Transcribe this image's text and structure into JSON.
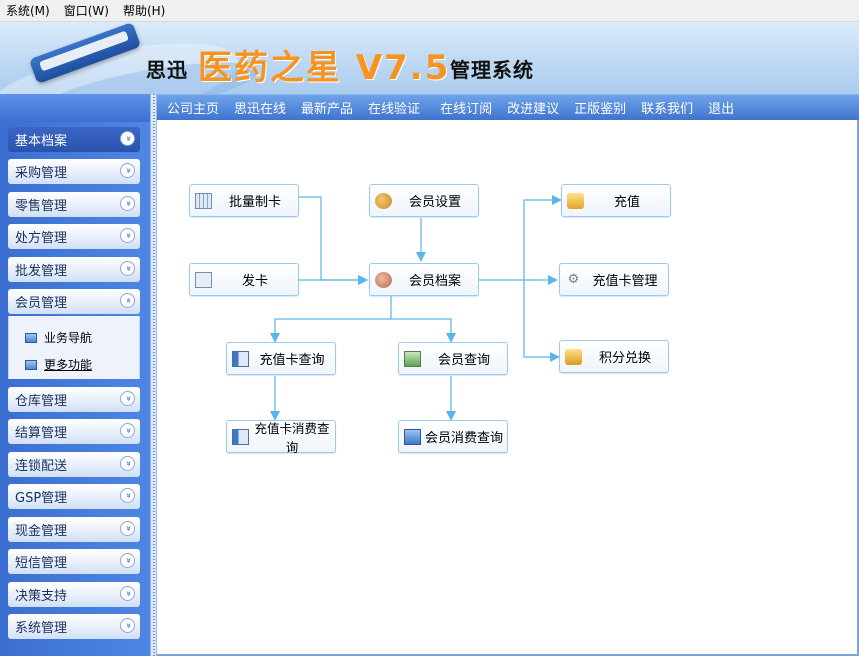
{
  "menubar": {
    "items": [
      "系统(M)",
      "窗口(W)",
      "帮助(H)"
    ]
  },
  "banner": {
    "company": "思迅",
    "product": "医药之星 V7.5",
    "suffix": "管理系统"
  },
  "topnav": {
    "links": [
      "公司主页",
      "思迅在线",
      "最新产品",
      "在线验证",
      "在线订阅",
      "改进建议",
      "正版鉴别",
      "联系我们",
      "退出"
    ]
  },
  "sidebar": {
    "items": [
      "基本档案",
      "采购管理",
      "零售管理",
      "处方管理",
      "批发管理",
      "会员管理",
      "仓库管理",
      "结算管理",
      "连锁配送",
      "GSP管理",
      "现金管理",
      "短信管理",
      "决策支持",
      "系统管理"
    ],
    "active_item": "基本档案",
    "expanded_item": "会员管理",
    "submenu": [
      "业务导航",
      "更多功能"
    ],
    "chevron_down": "»",
    "chevron_up": "«"
  },
  "flow": {
    "batch_card": "批量制卡",
    "issue_card": "发卡",
    "member_settings": "会员设置",
    "member_file": "会员档案",
    "recharge": "充值",
    "recharge_card_mgmt": "充值卡管理",
    "points_exchange": "积分兑换",
    "recharge_card_query": "充值卡查询",
    "member_query": "会员查询",
    "recharge_card_consumption_query": "充值卡消费查询",
    "member_consumption_query": "会员消费查询"
  },
  "icons": {
    "batch_card": "calendar-grid-icon",
    "issue_card": "cards-icon",
    "member_settings": "people-icon",
    "member_file": "people-file-icon",
    "recharge": "coins-icon",
    "recharge_card_mgmt": "gear-icon",
    "points_exchange": "coins-plus-icon",
    "recharge_card_query": "panel-icon",
    "member_query": "member-card-icon",
    "recharge_card_consumption_query": "panel-icon",
    "member_consumption_query": "monitor-icon"
  },
  "colors": {
    "accent": "#3f74cf",
    "connector": "#5bb6e8",
    "banner_title": "#f7931e"
  }
}
